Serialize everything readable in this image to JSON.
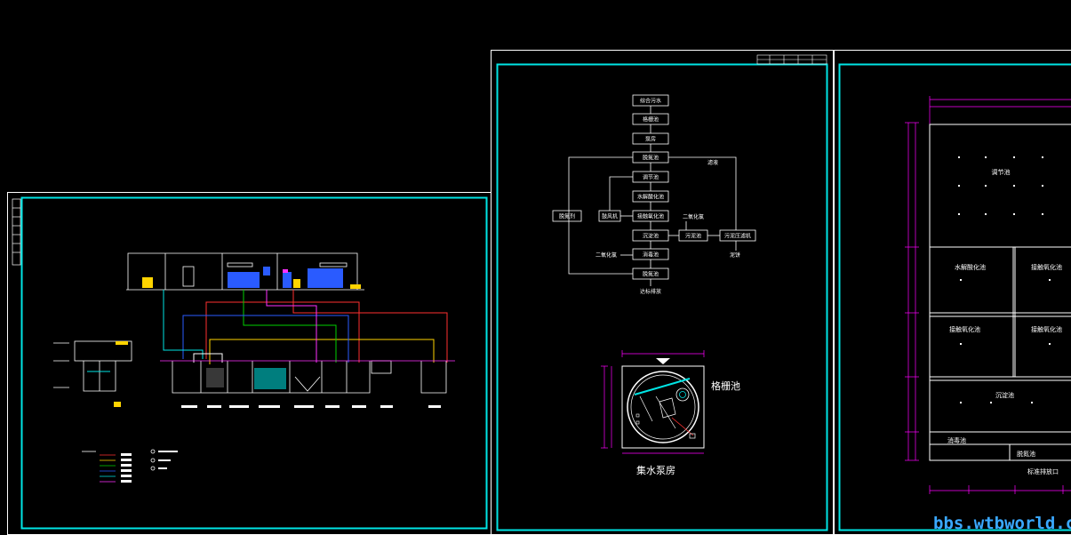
{
  "colors": {
    "background": "#000000",
    "frame_outer": "#ffffff",
    "frame_inner": "#00e5e5",
    "pipe_red": "#ff3030",
    "pipe_yellow": "#ffd400",
    "pipe_green": "#00d000",
    "pipe_blue": "#2a5bff",
    "pipe_magenta": "#ff30ff",
    "pipe_cyan": "#00e5e5",
    "dimension": "#ff00ff",
    "watermark": "#3aa8ff"
  },
  "flow_chart": {
    "main_steps": [
      "综合污水",
      "格栅池",
      "泵房",
      "脱氮池",
      "调节池",
      "水解酸化池",
      "接触氧化池",
      "沉淀池",
      "消毒池",
      "脱氮池"
    ],
    "final_label": "达标排放",
    "side_left": "脱氮剂",
    "side_blower": "鼓风机",
    "chlorine_1": "二氧化氯",
    "chlorine_2": "二氧化氯",
    "sludge_1": "污泥池",
    "sludge_2": "污泥压滤机",
    "filtrate": "滤液",
    "sludge_out": "泥饼"
  },
  "pump_room": {
    "side_label": "格栅池",
    "caption": "集水泵房"
  },
  "plan_view": {
    "tanks": [
      "调节池",
      "水解酸化池",
      "接触氧化池",
      "接触氧化池",
      "接触氧化池",
      "沉淀池",
      "消毒池",
      "脱氮池"
    ],
    "outlet_label": "标准排放口"
  },
  "watermark": "bbs.wtbworld.com"
}
